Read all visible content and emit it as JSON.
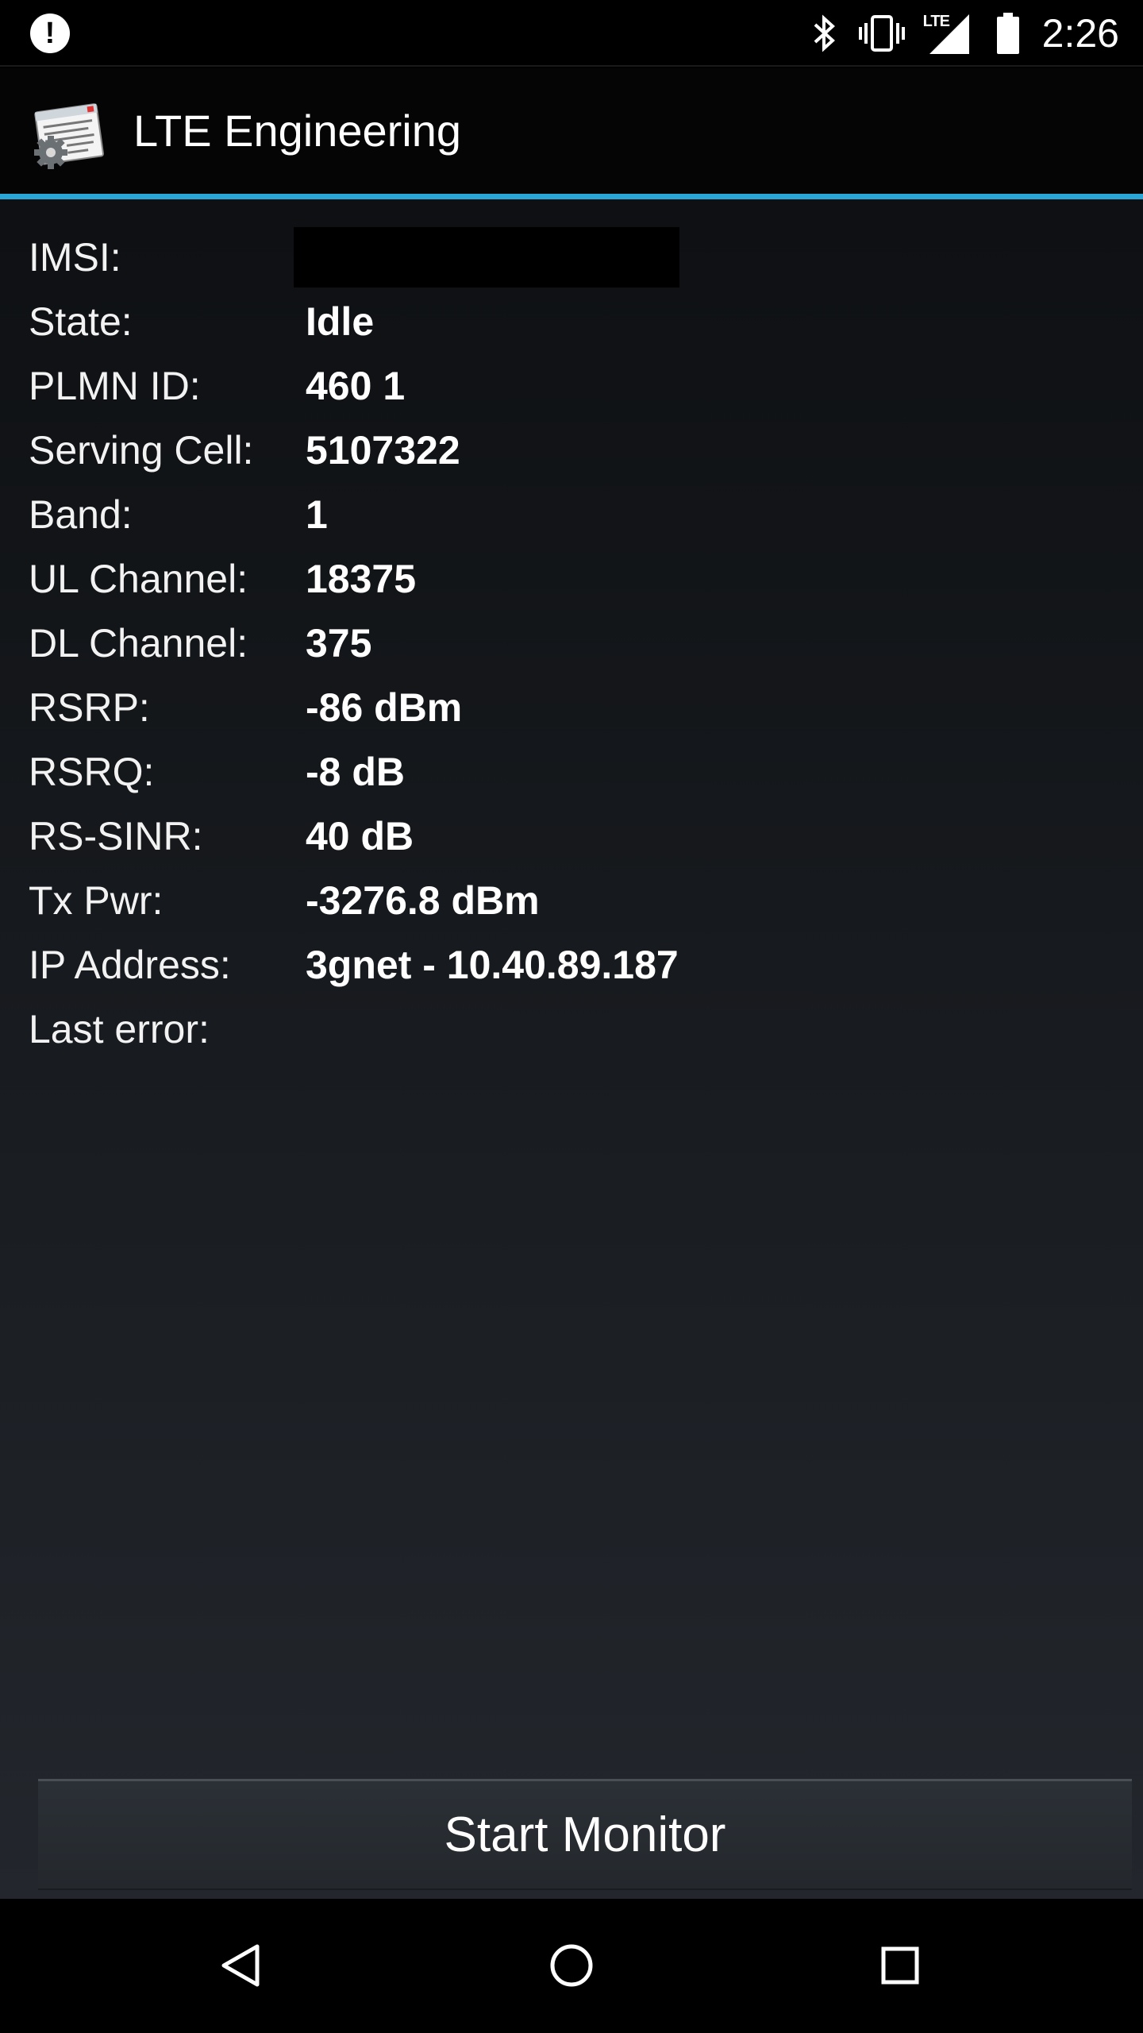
{
  "status_bar": {
    "time": "2:26",
    "network_label": "LTE",
    "icons": [
      "alert-icon",
      "bluetooth-icon",
      "vibrate-icon",
      "lte-signal-icon",
      "battery-icon"
    ]
  },
  "app": {
    "title": "LTE Engineering",
    "icon": "settings-window-icon",
    "accent_color": "#2aa6d6"
  },
  "info_rows": [
    {
      "label": "IMSI:",
      "value": ""
    },
    {
      "label": "State:",
      "value": "Idle"
    },
    {
      "label": "PLMN ID:",
      "value": "460 1"
    },
    {
      "label": "Serving Cell:",
      "value": "5107322"
    },
    {
      "label": "Band:",
      "value": "1"
    },
    {
      "label": "UL Channel:",
      "value": "18375"
    },
    {
      "label": "DL Channel:",
      "value": "375"
    },
    {
      "label": "RSRP:",
      "value": "-86 dBm"
    },
    {
      "label": "RSRQ:",
      "value": "-8 dB"
    },
    {
      "label": "RS-SINR:",
      "value": "40 dB"
    },
    {
      "label": "Tx Pwr:",
      "value": "-3276.8 dBm"
    },
    {
      "label": "IP Address:",
      "value": "3gnet - 10.40.89.187"
    },
    {
      "label": "Last error:",
      "value": ""
    }
  ],
  "button": {
    "start_label": "Start Monitor"
  },
  "nav_bar": {
    "icons": [
      "back-icon",
      "home-icon",
      "recents-icon"
    ]
  }
}
